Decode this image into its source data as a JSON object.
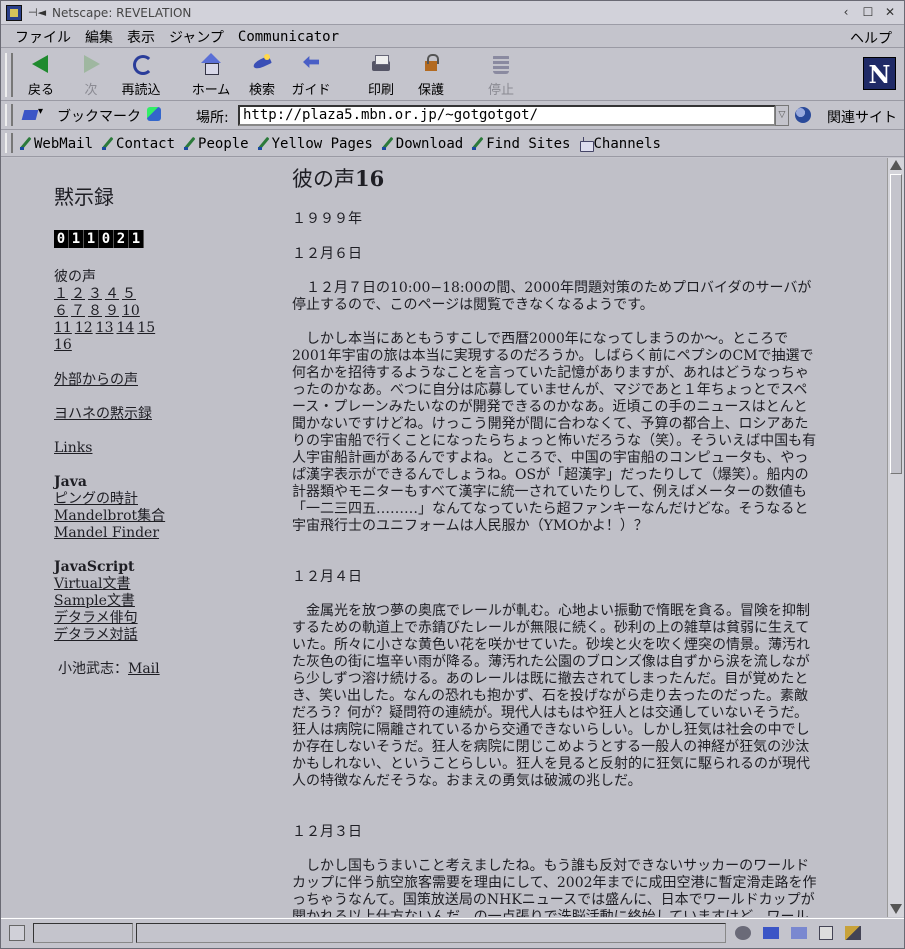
{
  "window": {
    "title": "Netscape: REVELATION"
  },
  "menu": {
    "items": [
      "ファイル",
      "編集",
      "表示",
      "ジャンプ",
      "Communicator"
    ],
    "help": "ヘルプ"
  },
  "toolbar": {
    "back": "戻る",
    "forward": "次",
    "reload": "再読込",
    "home": "ホーム",
    "search": "検索",
    "guide": "ガイド",
    "print": "印刷",
    "security": "保護",
    "stop": "停止"
  },
  "location": {
    "bookmarks_label": "ブックマーク",
    "location_label": "場所:",
    "url": "http://plaza5.mbn.or.jp/~gotgotgot/",
    "related_label": "関連サイト"
  },
  "personal_toolbar": {
    "items": [
      "WebMail",
      "Contact",
      "People",
      "Yellow Pages",
      "Download",
      "Find Sites",
      "Channels"
    ]
  },
  "sidebar": {
    "title": "黙示録",
    "counter_digits": [
      "0",
      "1",
      "1",
      "0",
      "2",
      "1"
    ],
    "voice_heading": "彼の声",
    "voice_links": [
      "１",
      "２",
      "３",
      "４",
      "５",
      "６",
      "７",
      "８",
      "９",
      "10",
      "11",
      "12",
      "13",
      "14",
      "15",
      "16"
    ],
    "outer_voice": "外部からの声",
    "john": "ヨハネの黙示録",
    "links": "Links",
    "java_heading": "Java",
    "java_links": [
      "ピングの時計",
      "Mandelbrot集合",
      "Mandel Finder"
    ],
    "js_heading": "JavaScript",
    "js_links": [
      "Virtual文書",
      "Sample文書",
      "デタラメ俳句",
      "デタラメ対話"
    ],
    "author_prefix": "小池武志：",
    "mail": "Mail"
  },
  "article": {
    "title_prefix": "彼の声",
    "title_number": "16",
    "year": "１９９９年",
    "entries": [
      {
        "date": "１２月６日",
        "paragraphs": [
          "１２月７日の10:00−18:00の間、2000年問題対策のためプロバイダのサーバが停止するので、このページは閲覧できなくなるようです。",
          "しかし本当にあともうすこしで西暦2000年になってしまうのか〜。ところで2001年宇宙の旅は本当に実現するのだろうか。しばらく前にペプシのCMで抽選で何名かを招待するようなことを言っていた記憶がありますが、あれはどうなっちゃったのかなあ。べつに自分は応募していませんが、マジであと１年ちょっとでスペース・プレーンみたいなのが開発できるのかなあ。近頃この手のニュースはとんと聞かないですけどね。けっこう開発が間に合わなくて、予算の都合上、ロシアあたりの宇宙船で行くことになったらちょっと怖いだろうな（笑）。そういえば中国も有人宇宙船計画があるんですよね。ところで、中国の宇宙船のコンピュータも、やっぱ漢字表示ができるんでしょうね。OSが「超漢字」だったりして（爆笑）。船内の計器類やモニターもすべて漢字に統一されていたりして、例えばメーターの数値も「一二三四五………」なんてなっていたら超ファンキーなんだけどな。そうなると宇宙飛行士のユニフォームは人民服か（YMOかよ！）？"
        ]
      },
      {
        "date": "１２月４日",
        "paragraphs": [
          "金属光を放つ夢の奥底でレールが軋む。心地よい振動で惰眠を貪る。冒険を抑制するための軌道上で赤錆びたレールが無限に続く。砂利の上の雑草は貧弱に生えていた。所々に小さな黄色い花を咲かせていた。砂埃と火を吹く煙突の情景。薄汚れた灰色の街に塩辛い雨が降る。薄汚れた公園のブロンズ像は自ずから涙を流しながら少しずつ溶け続ける。あのレールは既に撤去されてしまったんだ。目が覚めたとき、笑い出した。なんの恐れも抱かず、石を投げながら走り去ったのだった。素敵だろう？何が？疑問符の連続が。現代人はもはや狂人とは交通していないそうだ。狂人は病院に隔離されているから交通できないらしい。しかし狂気は社会の中でしか存在しないそうだ。狂人を病院に閉じこめようとする一般人の神経が狂気の沙汰かもしれない、ということらしい。狂人を見ると反射的に狂気に駆られるのが現代人の特徴なんだそうな。おまえの勇気は破滅の兆しだ。"
        ]
      },
      {
        "date": "１２月３日",
        "paragraphs": [
          "しかし国もうまいこと考えましたね。もう誰も反対できないサッカーのワールドカップに伴う航空旅客需要を理由にして、2002年までに成田空港に暫定滑走路を作っちゃうなんて。国策放送局のNHKニュースでは盛んに、日本でワールドカップが開かれる以上仕方ないんだ、の一点張りで洗脳活動に終始していますけど。ワール"
        ]
      }
    ]
  }
}
